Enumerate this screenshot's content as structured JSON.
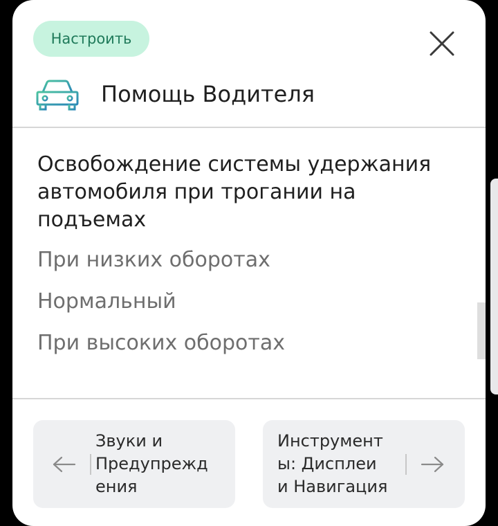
{
  "header": {
    "configure_label": "Настроить",
    "close_icon": "close-icon",
    "section_icon": "car-icon",
    "section_title": "Помощь Водителя"
  },
  "setting": {
    "title": "Освобождение системы удержания автомобиля при трогании на подъемах",
    "options": [
      {
        "label": "При низких оборотах"
      },
      {
        "label": "Нормальный"
      },
      {
        "label": "При высоких оборотах"
      }
    ]
  },
  "footer": {
    "prev": {
      "label": "Звуки и\nПредупрежд\nения",
      "icon": "arrow-left-icon"
    },
    "next": {
      "label": "Инструмент\nы: Дисплеи\nи Навигация",
      "icon": "arrow-right-icon"
    }
  },
  "colors": {
    "accent_bg": "#c7f3df",
    "accent_text": "#1f7a5a",
    "icon_teal": "#3aa7a0"
  }
}
